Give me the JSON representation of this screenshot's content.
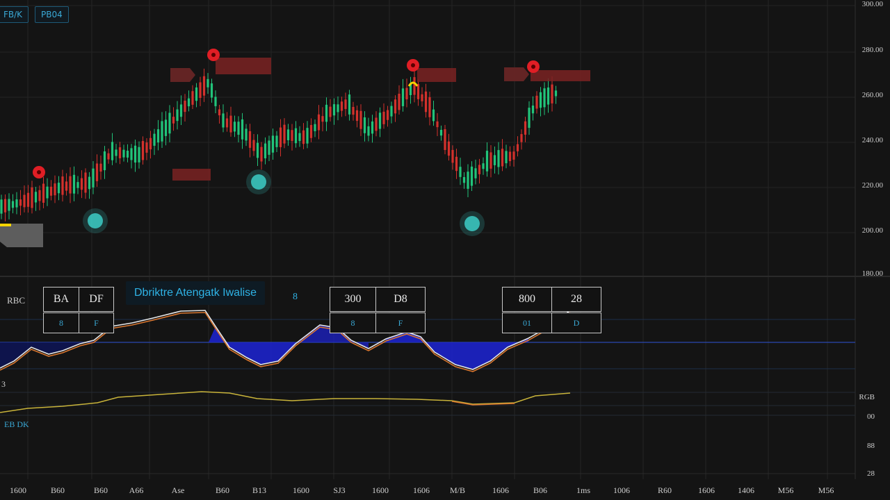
{
  "toolbar": {
    "tag_left": "FB/K",
    "tag_right": "PB04"
  },
  "price_axis": {
    "labels": [
      "300.00",
      "280.00",
      "260.00",
      "240.00",
      "220.00",
      "200.00",
      "180.00"
    ]
  },
  "indicator": {
    "panel_label": "RBC",
    "title": "Dbriktre Atengatk Iwalise",
    "small_icon": "8",
    "box_a": {
      "top_left": "BA",
      "top_right": "DF",
      "bottom_left": "8",
      "bottom_right": "F"
    },
    "box_b": {
      "top_left": "300",
      "top_right": "D8",
      "bottom_left": "8",
      "bottom_right": "F"
    },
    "box_c": {
      "top_left": "800",
      "top_right": "28",
      "bottom_left": "01",
      "bottom_right": "D"
    }
  },
  "lower_panels": {
    "label_a": "3",
    "label_b": "EB DK",
    "right_labels": [
      "RGB",
      "00",
      "88",
      "28"
    ]
  },
  "time_axis": {
    "labels": [
      "1600",
      "B60",
      "B60",
      "A66",
      "Ase",
      "B60",
      "B13",
      "1600",
      "SJ3",
      "1600",
      "1606",
      "M/B",
      "1606",
      "B06",
      "1ms",
      "1006",
      "R60",
      "1606",
      "1406",
      "M56",
      "M56"
    ]
  },
  "colors": {
    "background": "#141414",
    "bull": "#21c47a",
    "bear": "#d3312c",
    "signal_red": "#e01e25",
    "signal_cyan": "#3fd6d0",
    "macd_fill": "#1c22c9",
    "line_white": "#e6e6e6",
    "line_orange": "#d9762f",
    "line_yellow": "#c9b43a"
  }
}
